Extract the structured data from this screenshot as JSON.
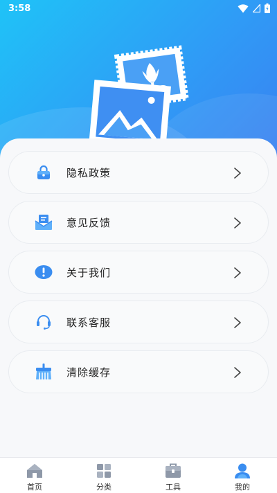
{
  "status_bar": {
    "time": "3:58"
  },
  "menu": {
    "items": [
      {
        "label": "隐私政策",
        "icon": "lock-icon"
      },
      {
        "label": "意见反馈",
        "icon": "mail-feedback-icon"
      },
      {
        "label": "关于我们",
        "icon": "info-icon"
      },
      {
        "label": "联系客服",
        "icon": "headset-icon"
      },
      {
        "label": "清除缓存",
        "icon": "broom-icon"
      }
    ]
  },
  "tabbar": {
    "tabs": [
      {
        "label": "首页",
        "icon": "home-icon",
        "active": false
      },
      {
        "label": "分类",
        "icon": "grid-icon",
        "active": false
      },
      {
        "label": "工具",
        "icon": "toolbox-icon",
        "active": false
      },
      {
        "label": "我的",
        "icon": "user-icon",
        "active": true
      }
    ]
  },
  "colors": {
    "accent": "#2f9cf6",
    "icon_blue": "#3a8df0",
    "tab_inactive": "#8e98a8"
  }
}
